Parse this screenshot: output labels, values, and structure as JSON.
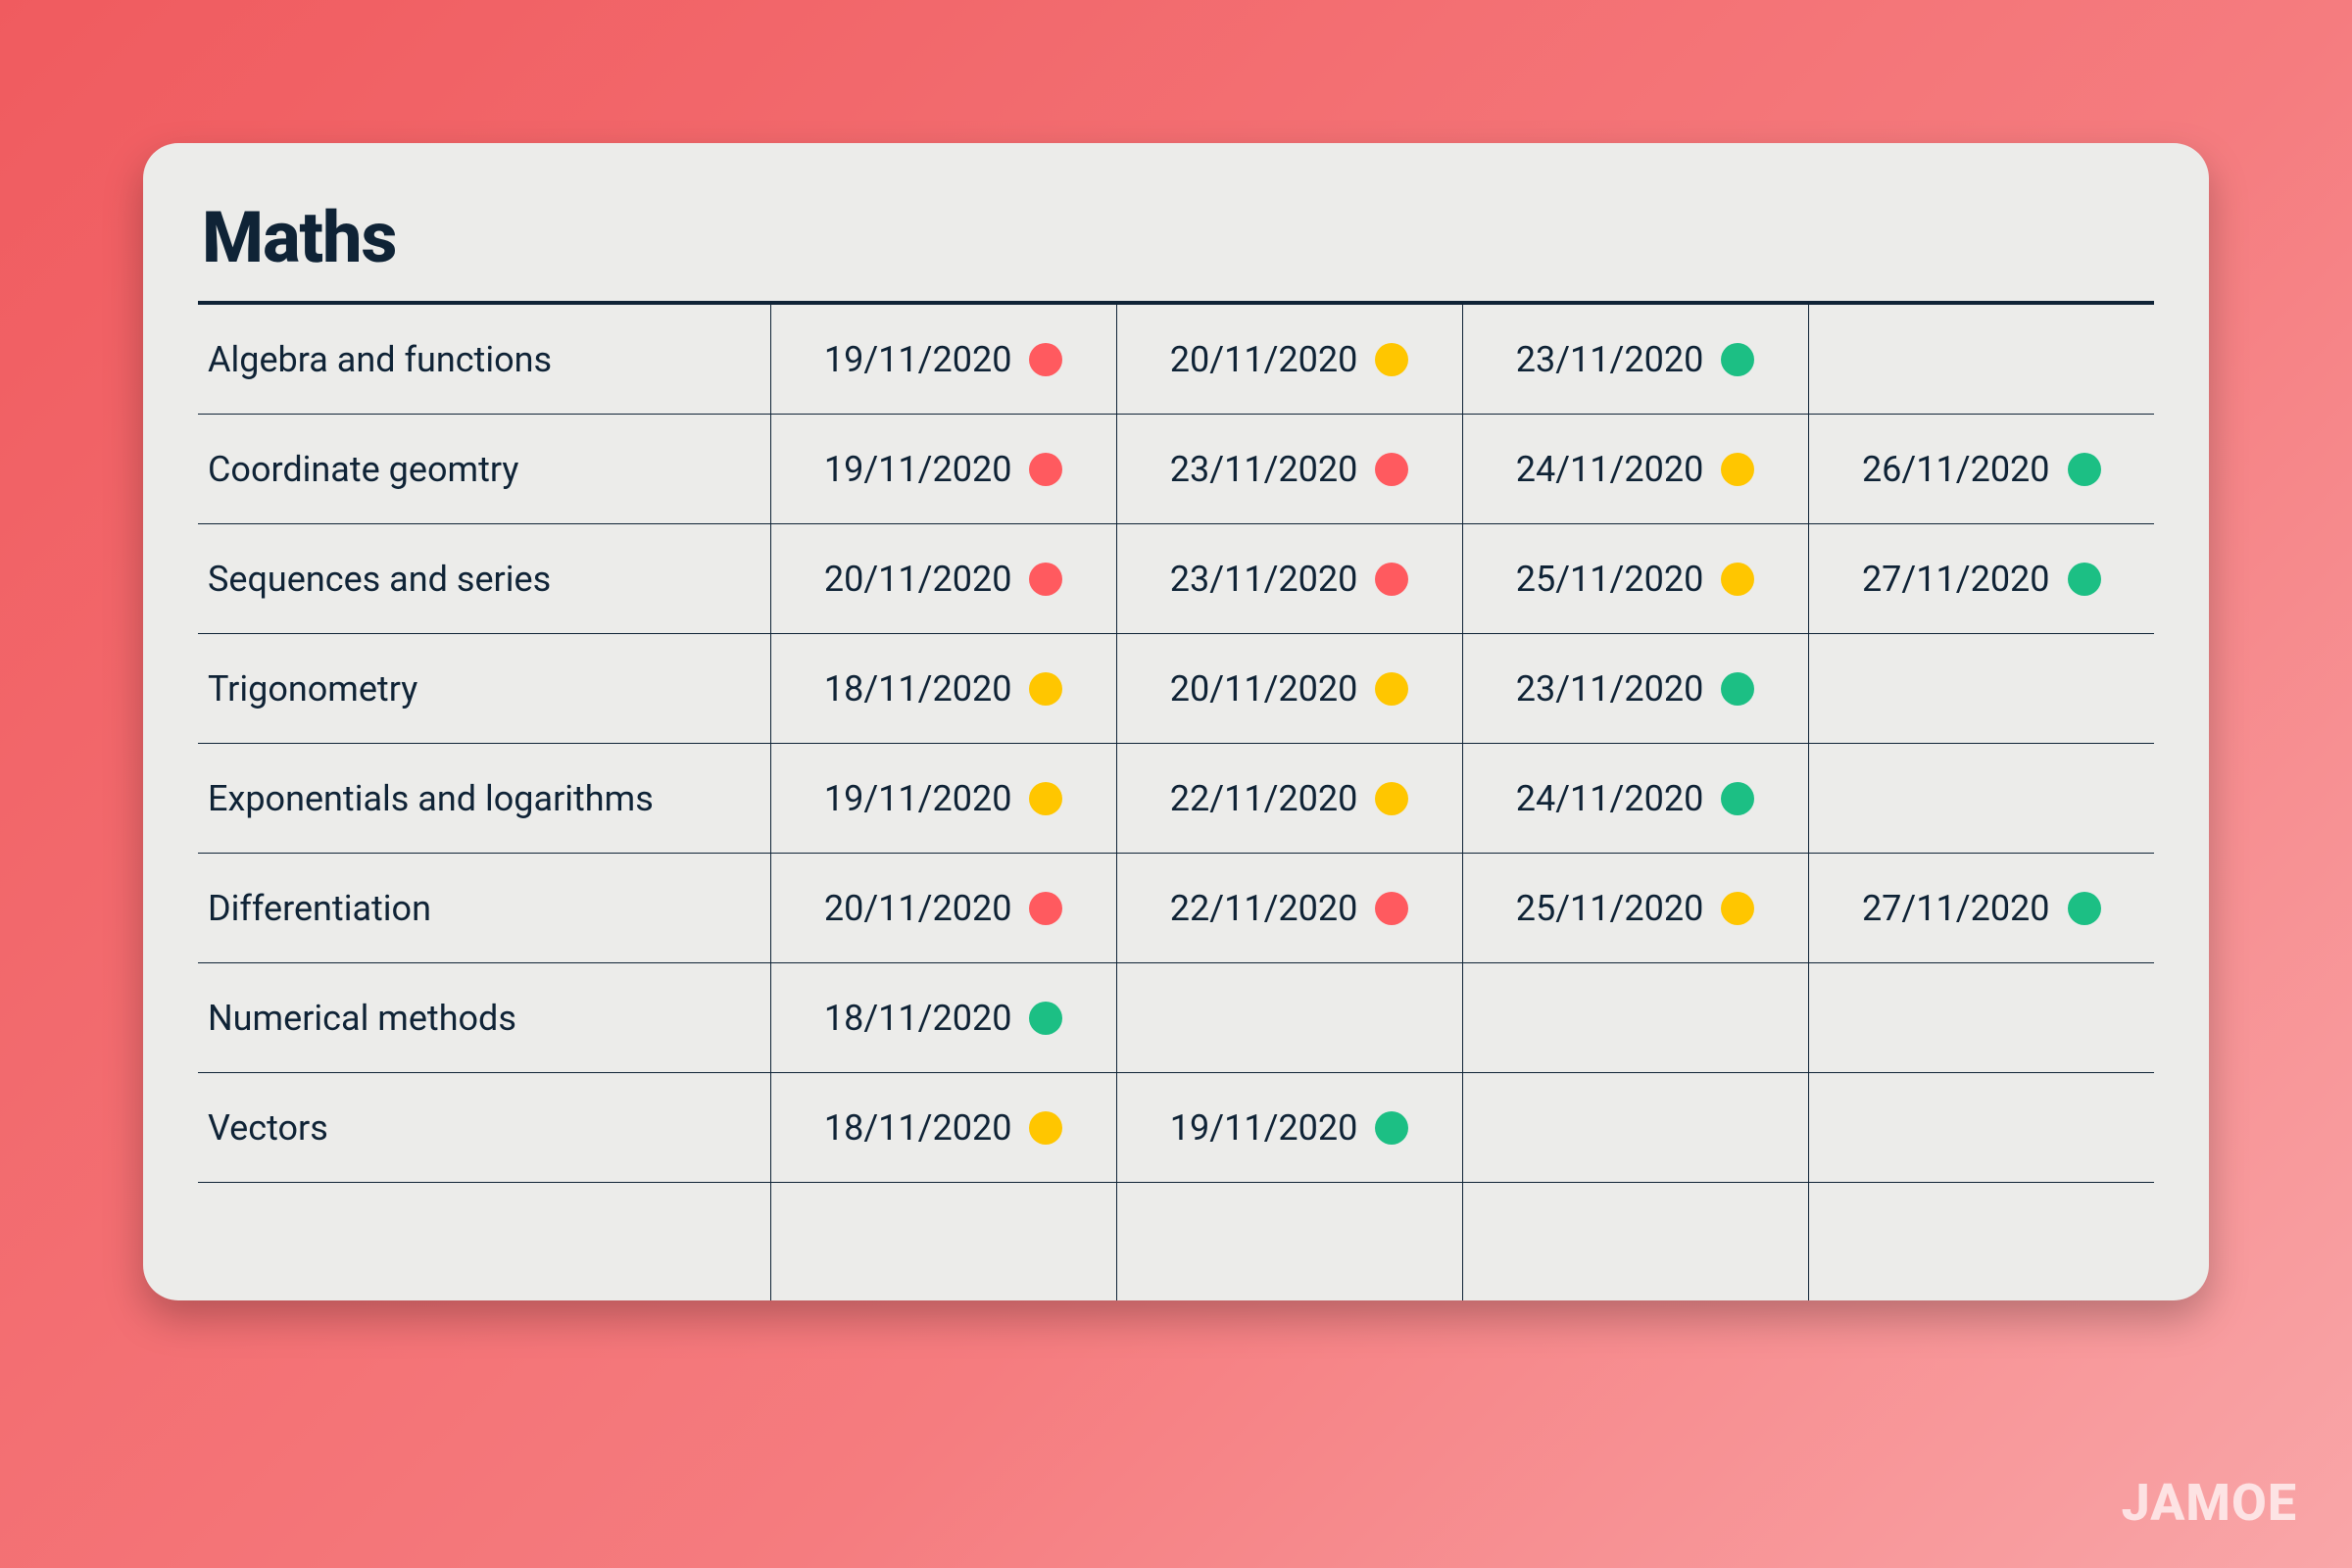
{
  "title": "Maths",
  "brand": "JAMOE",
  "status_colors": {
    "red": "#ff5a5f",
    "amber": "#ffc600",
    "green": "#1cbf84"
  },
  "rows": [
    {
      "topic": "Algebra and functions",
      "attempts": [
        {
          "date": "19/11/2020",
          "status": "red"
        },
        {
          "date": "20/11/2020",
          "status": "amber"
        },
        {
          "date": "23/11/2020",
          "status": "green"
        },
        null
      ]
    },
    {
      "topic": "Coordinate geomtry",
      "attempts": [
        {
          "date": "19/11/2020",
          "status": "red"
        },
        {
          "date": "23/11/2020",
          "status": "red"
        },
        {
          "date": "24/11/2020",
          "status": "amber"
        },
        {
          "date": "26/11/2020",
          "status": "green"
        }
      ]
    },
    {
      "topic": "Sequences and series",
      "attempts": [
        {
          "date": "20/11/2020",
          "status": "red"
        },
        {
          "date": "23/11/2020",
          "status": "red"
        },
        {
          "date": "25/11/2020",
          "status": "amber"
        },
        {
          "date": "27/11/2020",
          "status": "green"
        }
      ]
    },
    {
      "topic": "Trigonometry",
      "attempts": [
        {
          "date": "18/11/2020",
          "status": "amber"
        },
        {
          "date": "20/11/2020",
          "status": "amber"
        },
        {
          "date": "23/11/2020",
          "status": "green"
        },
        null
      ]
    },
    {
      "topic": "Exponentials and logarithms",
      "attempts": [
        {
          "date": "19/11/2020",
          "status": "amber"
        },
        {
          "date": "22/11/2020",
          "status": "amber"
        },
        {
          "date": "24/11/2020",
          "status": "green"
        },
        null
      ]
    },
    {
      "topic": "Differentiation",
      "attempts": [
        {
          "date": "20/11/2020",
          "status": "red"
        },
        {
          "date": "22/11/2020",
          "status": "red"
        },
        {
          "date": "25/11/2020",
          "status": "amber"
        },
        {
          "date": "27/11/2020",
          "status": "green"
        }
      ]
    },
    {
      "topic": "Numerical methods",
      "attempts": [
        {
          "date": "18/11/2020",
          "status": "green"
        },
        null,
        null,
        null
      ]
    },
    {
      "topic": "Vectors",
      "attempts": [
        {
          "date": "18/11/2020",
          "status": "amber"
        },
        {
          "date": "19/11/2020",
          "status": "green"
        },
        null,
        null
      ]
    }
  ]
}
